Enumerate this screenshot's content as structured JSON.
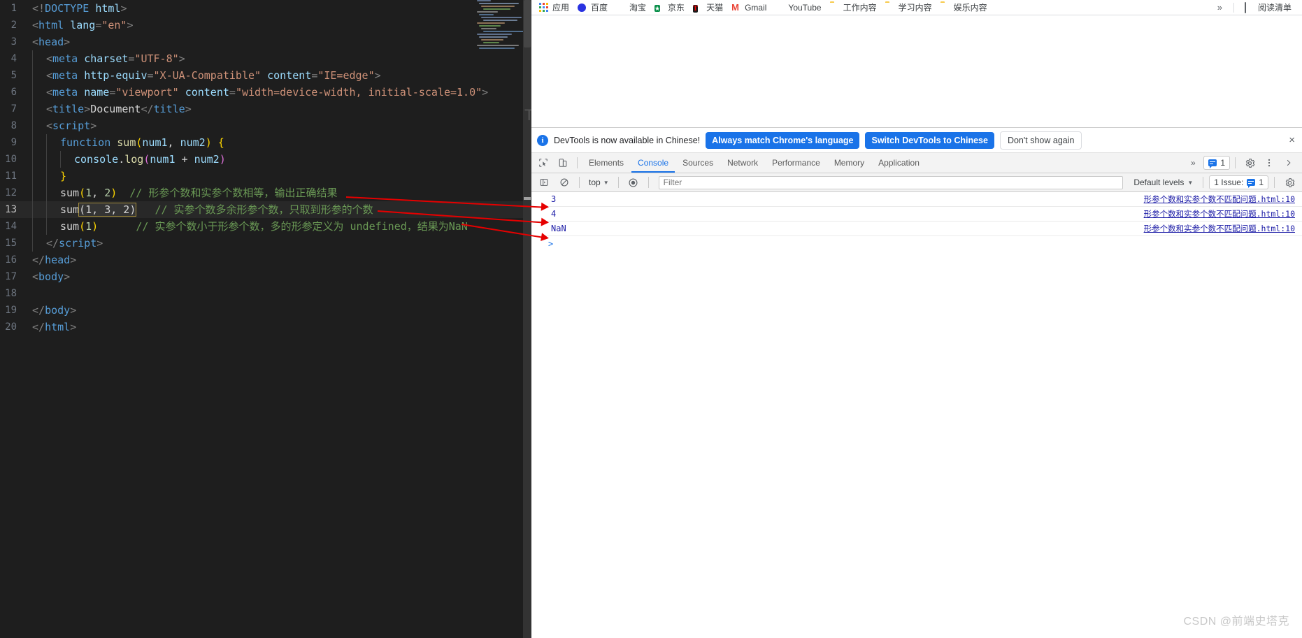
{
  "editor": {
    "lines": [
      {
        "num": "1",
        "indent": 0,
        "tokens": [
          {
            "t": "punc",
            "v": "<!"
          },
          {
            "t": "tag",
            "v": "DOCTYPE"
          },
          {
            "t": "plain",
            "v": " "
          },
          {
            "t": "attr",
            "v": "html"
          },
          {
            "t": "punc",
            "v": ">"
          }
        ]
      },
      {
        "num": "2",
        "indent": 0,
        "tokens": [
          {
            "t": "punc",
            "v": "<"
          },
          {
            "t": "tag",
            "v": "html"
          },
          {
            "t": "plain",
            "v": " "
          },
          {
            "t": "attr",
            "v": "lang"
          },
          {
            "t": "punc",
            "v": "="
          },
          {
            "t": "str",
            "v": "\"en\""
          },
          {
            "t": "punc",
            "v": ">"
          }
        ]
      },
      {
        "num": "3",
        "indent": 0,
        "tokens": [
          {
            "t": "punc",
            "v": "<"
          },
          {
            "t": "tag",
            "v": "head"
          },
          {
            "t": "punc",
            "v": ">"
          }
        ]
      },
      {
        "num": "4",
        "indent": 1,
        "tokens": [
          {
            "t": "punc",
            "v": "<"
          },
          {
            "t": "tag",
            "v": "meta"
          },
          {
            "t": "plain",
            "v": " "
          },
          {
            "t": "attr",
            "v": "charset"
          },
          {
            "t": "punc",
            "v": "="
          },
          {
            "t": "str",
            "v": "\"UTF-8\""
          },
          {
            "t": "punc",
            "v": ">"
          }
        ]
      },
      {
        "num": "5",
        "indent": 1,
        "tokens": [
          {
            "t": "punc",
            "v": "<"
          },
          {
            "t": "tag",
            "v": "meta"
          },
          {
            "t": "plain",
            "v": " "
          },
          {
            "t": "attr",
            "v": "http-equiv"
          },
          {
            "t": "punc",
            "v": "="
          },
          {
            "t": "str",
            "v": "\"X-UA-Compatible\""
          },
          {
            "t": "plain",
            "v": " "
          },
          {
            "t": "attr",
            "v": "content"
          },
          {
            "t": "punc",
            "v": "="
          },
          {
            "t": "str",
            "v": "\"IE=edge\""
          },
          {
            "t": "punc",
            "v": ">"
          }
        ]
      },
      {
        "num": "6",
        "indent": 1,
        "tokens": [
          {
            "t": "punc",
            "v": "<"
          },
          {
            "t": "tag",
            "v": "meta"
          },
          {
            "t": "plain",
            "v": " "
          },
          {
            "t": "attr",
            "v": "name"
          },
          {
            "t": "punc",
            "v": "="
          },
          {
            "t": "str",
            "v": "\"viewport\""
          },
          {
            "t": "plain",
            "v": " "
          },
          {
            "t": "attr",
            "v": "content"
          },
          {
            "t": "punc",
            "v": "="
          },
          {
            "t": "str",
            "v": "\"width=device-width, initial-scale=1.0\""
          },
          {
            "t": "punc",
            "v": ">"
          }
        ]
      },
      {
        "num": "7",
        "indent": 1,
        "tokens": [
          {
            "t": "punc",
            "v": "<"
          },
          {
            "t": "tag",
            "v": "title"
          },
          {
            "t": "punc",
            "v": ">"
          },
          {
            "t": "plain",
            "v": "Document"
          },
          {
            "t": "punc",
            "v": "</"
          },
          {
            "t": "tag",
            "v": "title"
          },
          {
            "t": "punc",
            "v": ">"
          }
        ]
      },
      {
        "num": "8",
        "indent": 1,
        "tokens": [
          {
            "t": "punc",
            "v": "<"
          },
          {
            "t": "tag",
            "v": "script"
          },
          {
            "t": "punc",
            "v": ">"
          }
        ]
      },
      {
        "num": "9",
        "indent": 2,
        "tokens": [
          {
            "t": "kw",
            "v": "function"
          },
          {
            "t": "plain",
            "v": " "
          },
          {
            "t": "fn",
            "v": "sum"
          },
          {
            "t": "brace1",
            "v": "("
          },
          {
            "t": "param",
            "v": "num1"
          },
          {
            "t": "op",
            "v": ", "
          },
          {
            "t": "param",
            "v": "num2"
          },
          {
            "t": "brace1",
            "v": ")"
          },
          {
            "t": "plain",
            "v": " "
          },
          {
            "t": "brace1",
            "v": "{"
          }
        ]
      },
      {
        "num": "10",
        "indent": 3,
        "tokens": [
          {
            "t": "obj",
            "v": "console"
          },
          {
            "t": "op",
            "v": "."
          },
          {
            "t": "meth",
            "v": "log"
          },
          {
            "t": "brace2",
            "v": "("
          },
          {
            "t": "var",
            "v": "num1"
          },
          {
            "t": "op",
            "v": " + "
          },
          {
            "t": "var",
            "v": "num2"
          },
          {
            "t": "brace2",
            "v": ")"
          }
        ]
      },
      {
        "num": "11",
        "indent": 2,
        "tokens": [
          {
            "t": "brace1",
            "v": "}"
          }
        ]
      },
      {
        "num": "12",
        "indent": 2,
        "tokens": [
          {
            "t": "plain",
            "v": "sum"
          },
          {
            "t": "brace1",
            "v": "("
          },
          {
            "t": "num",
            "v": "1"
          },
          {
            "t": "op",
            "v": ", "
          },
          {
            "t": "num",
            "v": "2"
          },
          {
            "t": "brace1",
            "v": ")"
          },
          {
            "t": "plain",
            "v": "  "
          },
          {
            "t": "comment",
            "v": "// 形参个数和实参个数相等，输出正确结果"
          }
        ]
      },
      {
        "num": "13",
        "indent": 2,
        "current": true,
        "tokens": [
          {
            "t": "plain",
            "v": "sum"
          },
          {
            "t": "sel",
            "v": "(1, 3, 2)"
          },
          {
            "t": "plain",
            "v": "   "
          },
          {
            "t": "comment",
            "v": "// 实参个数多余形参个数，只取到形参的个数"
          }
        ]
      },
      {
        "num": "14",
        "indent": 2,
        "tokens": [
          {
            "t": "plain",
            "v": "sum"
          },
          {
            "t": "brace1",
            "v": "("
          },
          {
            "t": "num",
            "v": "1"
          },
          {
            "t": "brace1",
            "v": ")"
          },
          {
            "t": "plain",
            "v": "      "
          },
          {
            "t": "comment",
            "v": "// 实参个数小于形参个数，多的形参定义为 undefined，结果为NaN"
          }
        ]
      },
      {
        "num": "15",
        "indent": 1,
        "tokens": [
          {
            "t": "punc",
            "v": "</"
          },
          {
            "t": "tag",
            "v": "script"
          },
          {
            "t": "punc",
            "v": ">"
          }
        ]
      },
      {
        "num": "16",
        "indent": 0,
        "tokens": [
          {
            "t": "punc",
            "v": "</"
          },
          {
            "t": "tag",
            "v": "head"
          },
          {
            "t": "punc",
            "v": ">"
          }
        ]
      },
      {
        "num": "17",
        "indent": 0,
        "tokens": [
          {
            "t": "punc",
            "v": "<"
          },
          {
            "t": "tag",
            "v": "body"
          },
          {
            "t": "punc",
            "v": ">"
          }
        ]
      },
      {
        "num": "18",
        "indent": 0,
        "tokens": []
      },
      {
        "num": "19",
        "indent": 0,
        "tokens": [
          {
            "t": "punc",
            "v": "</"
          },
          {
            "t": "tag",
            "v": "body"
          },
          {
            "t": "punc",
            "v": ">"
          }
        ]
      },
      {
        "num": "20",
        "indent": 0,
        "tokens": [
          {
            "t": "punc",
            "v": "</"
          },
          {
            "t": "tag",
            "v": "html"
          },
          {
            "t": "punc",
            "v": ">"
          }
        ]
      }
    ],
    "ghost_letter": "T"
  },
  "bookmarks": {
    "items": [
      {
        "label": "应用",
        "icon": "apps-grid-icon"
      },
      {
        "label": "百度",
        "icon": "baidu-icon"
      },
      {
        "label": "淘宝",
        "icon": "taobao-icon"
      },
      {
        "label": "京东",
        "icon": "jd-icon"
      },
      {
        "label": "天猫",
        "icon": "tmall-icon"
      },
      {
        "label": "Gmail",
        "icon": "gmail-icon"
      },
      {
        "label": "YouTube",
        "icon": "youtube-icon"
      },
      {
        "label": "工作内容",
        "icon": "folder-icon"
      },
      {
        "label": "学习内容",
        "icon": "folder-icon"
      },
      {
        "label": "娱乐内容",
        "icon": "folder-icon"
      }
    ],
    "overflow_label": "»",
    "reading_list_label": "阅读清单"
  },
  "devtools": {
    "i18n_notice": {
      "message": "DevTools is now available in Chinese!",
      "primary_button": "Always match Chrome's language",
      "secondary_button": "Switch DevTools to Chinese",
      "dismiss_button": "Don't show again",
      "close_label": "×"
    },
    "tabs": [
      {
        "label": "Elements",
        "active": false
      },
      {
        "label": "Console",
        "active": true
      },
      {
        "label": "Sources",
        "active": false
      },
      {
        "label": "Network",
        "active": false
      },
      {
        "label": "Performance",
        "active": false
      },
      {
        "label": "Memory",
        "active": false
      },
      {
        "label": "Application",
        "active": false
      }
    ],
    "tabs_overflow": "»",
    "issues_chip_count": "1",
    "console_toolbar": {
      "context_label": "top",
      "filter_placeholder": "Filter",
      "levels_label": "Default levels",
      "issue_label": "1 Issue:",
      "issue_count": "1"
    },
    "console_rows": [
      {
        "value": "3",
        "source": "形参个数和实参个数不匹配问题.html:10"
      },
      {
        "value": "4",
        "source": "形参个数和实参个数不匹配问题.html:10"
      },
      {
        "value": "NaN",
        "source": "形参个数和实参个数不匹配问题.html:10"
      }
    ],
    "prompt_symbol": ">"
  },
  "watermark": "CSDN @前端史塔克",
  "colors": {
    "editor_bg": "#1e1e1e",
    "accent_blue": "#1a73e8",
    "annotation_red": "#e60000",
    "comment_green": "#6a9955",
    "console_value": "#1a1aa6"
  }
}
